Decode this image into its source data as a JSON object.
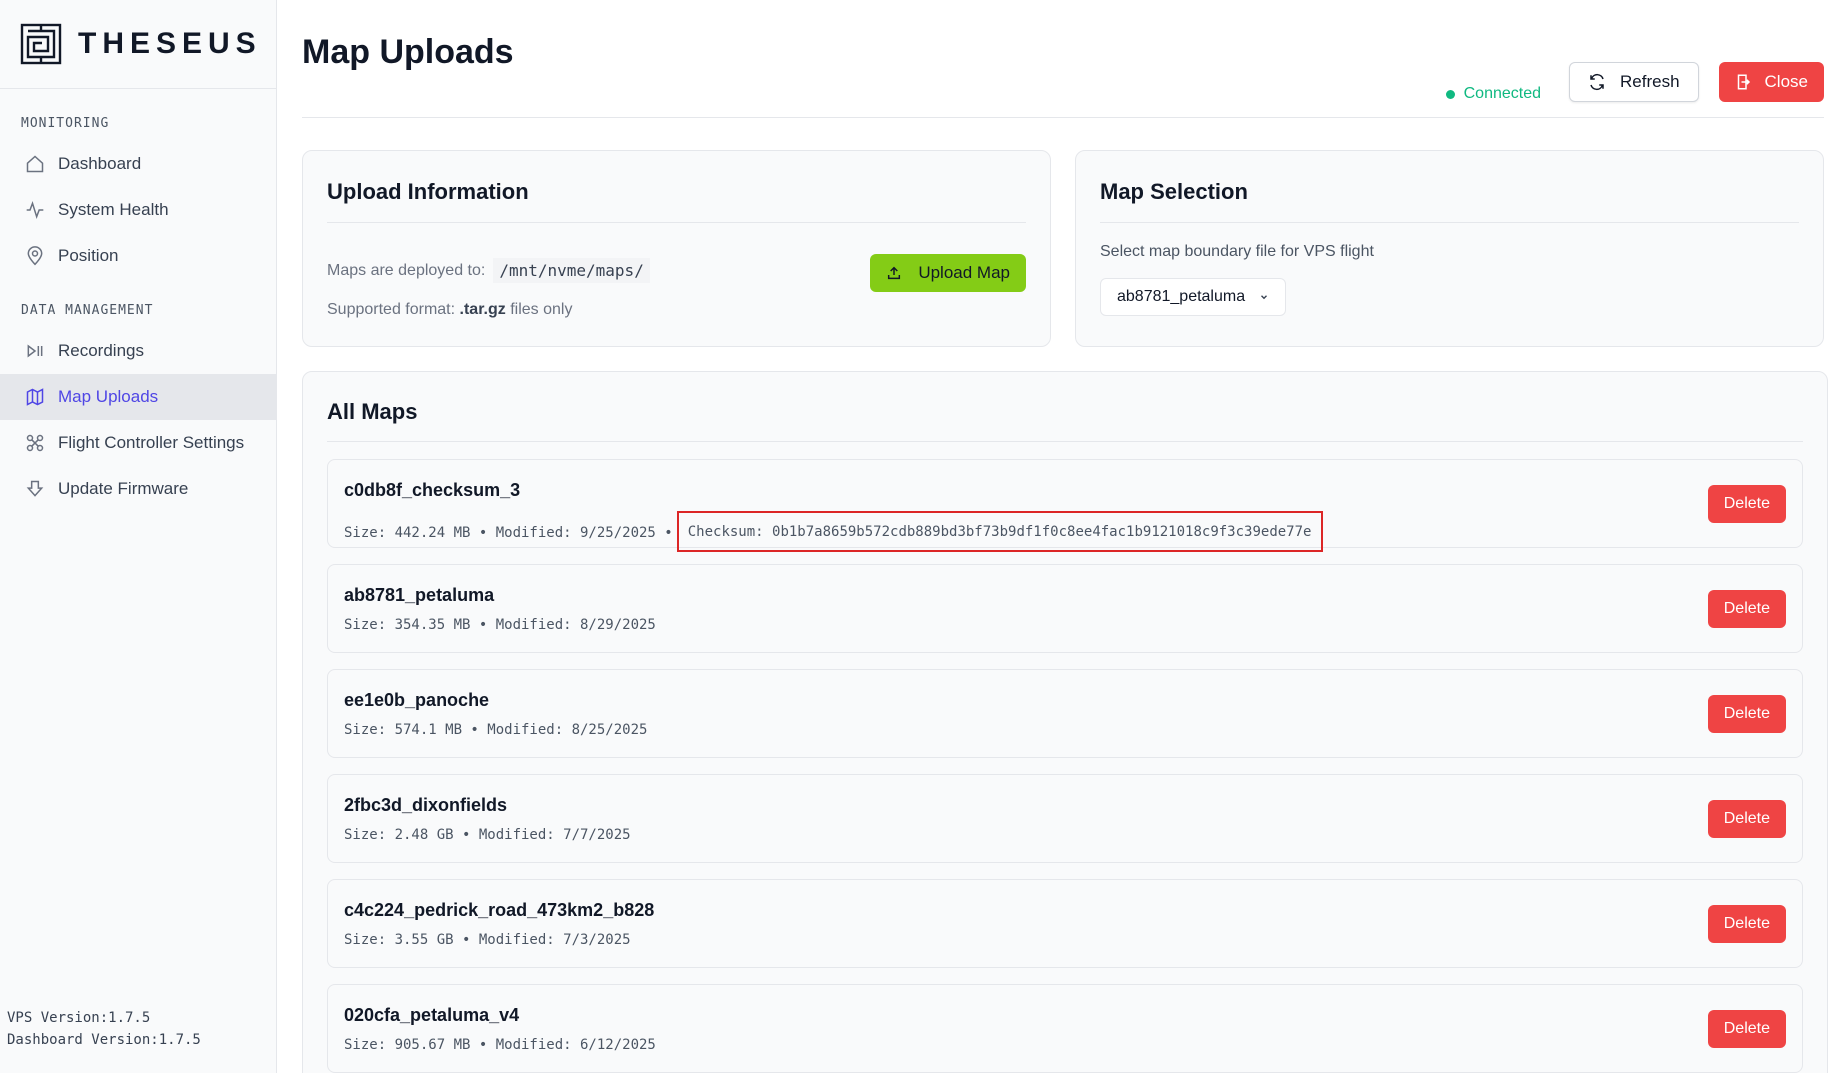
{
  "brand": {
    "name": "THESEUS"
  },
  "sidebar": {
    "sections": [
      {
        "label": "MONITORING"
      },
      {
        "label": "DATA MANAGEMENT"
      }
    ],
    "items": [
      {
        "label": "Dashboard",
        "icon": "home-icon"
      },
      {
        "label": "System Health",
        "icon": "activity-icon"
      },
      {
        "label": "Position",
        "icon": "map-pin-icon"
      },
      {
        "label": "Recordings",
        "icon": "recordings-icon"
      },
      {
        "label": "Map Uploads",
        "icon": "map-icon",
        "active": true
      },
      {
        "label": "Flight Controller Settings",
        "icon": "drone-icon"
      },
      {
        "label": "Update Firmware",
        "icon": "download-icon"
      }
    ],
    "version": {
      "vps": "VPS Version:1.7.5",
      "dashboard": "Dashboard Version:1.7.5"
    }
  },
  "header": {
    "title": "Map Uploads",
    "status": "Connected",
    "refresh_label": "Refresh",
    "close_label": "Close"
  },
  "upload": {
    "title": "Upload Information",
    "deployed_label": "Maps are deployed to:",
    "deployed_path": "/mnt/nvme/maps/",
    "format_prefix": "Supported format:",
    "format_ext": ".tar.gz",
    "format_suffix": "files only",
    "button_label": "Upload Map"
  },
  "selection": {
    "title": "Map Selection",
    "description": "Select map boundary file for VPS flight",
    "selected": "ab8781_petaluma"
  },
  "maps": {
    "title": "All Maps",
    "delete_label": "Delete",
    "items": [
      {
        "name": "c0db8f_checksum_3",
        "meta": "Size: 442.24 MB • Modified: 9/25/2025 •",
        "checksum": "Checksum: 0b1b7a8659b572cdb889bd3bf73b9df1f0c8ee4fac1b9121018c9f3c39ede77e"
      },
      {
        "name": "ab8781_petaluma",
        "meta": "Size: 354.35 MB • Modified: 8/29/2025"
      },
      {
        "name": "ee1e0b_panoche",
        "meta": "Size: 574.1 MB • Modified: 8/25/2025"
      },
      {
        "name": "2fbc3d_dixonfields",
        "meta": "Size: 2.48 GB • Modified: 7/7/2025"
      },
      {
        "name": "c4c224_pedrick_road_473km2_b828",
        "meta": "Size: 3.55 GB • Modified: 7/3/2025"
      },
      {
        "name": "020cfa_petaluma_v4",
        "meta": "Size: 905.67 MB • Modified: 6/12/2025"
      }
    ]
  },
  "colors": {
    "accent": "#4f46e5",
    "connected": "#10b981",
    "danger": "#ef4444",
    "upload": "#84cc16",
    "highlight": "#dc2626"
  }
}
